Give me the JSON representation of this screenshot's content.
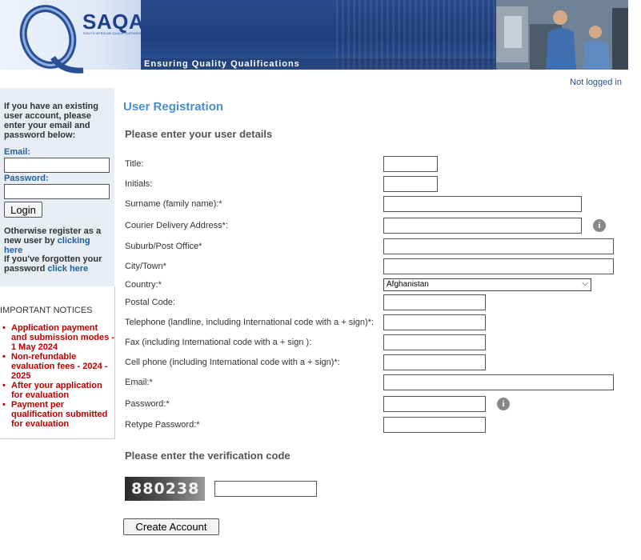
{
  "header": {
    "logo_text": "SAQA",
    "logo_subtext": "SOUTH AFRICAN QUALIFICATIONS AUTHORITY",
    "tagline": "Ensuring Quality Qualifications",
    "login_status": "Not logged in"
  },
  "sidebar": {
    "intro": "If you have an existing user account, please enter your email and password below:",
    "email_label": "Email:",
    "password_label": "Password:",
    "login_button": "Login",
    "register_text": "Otherwise register as a new user by",
    "register_link": "clicking here",
    "forgot_text": "If you've forgotten your password",
    "forgot_link": "click here",
    "notices_title": "IMPORTANT NOTICES",
    "notices": [
      "Application payment and submission modes - 1 May 2024",
      "Non-refundable evaluation fees - 2024 - 2025",
      "After your application for evaluation",
      "Payment per qualification submitted for evaluation"
    ]
  },
  "form": {
    "title": "User Registration",
    "details_heading": "Please enter your user details",
    "fields": {
      "title": "Title:",
      "initials": "Initials:",
      "surname": "Surname (family name):*",
      "courier": "Courier Delivery Address*:",
      "suburb": "Suburb/Post Office*",
      "city": "City/Town*",
      "country": "Country:*",
      "postal": "Postal Code:",
      "telephone": "Telephone (landline, including International code with a + sign)*:",
      "fax": "Fax (including International code with a + sign ):",
      "cell": "Cell phone (including International code with a + sign)*:",
      "email": "Email:*",
      "password": "Password:*",
      "retype": "Retype Password:*"
    },
    "country_value": "Afghanistan",
    "verification_heading": "Please enter the verification code",
    "captcha_code": "880238",
    "create_button": "Create Account"
  },
  "icons": {
    "info": "info-icon",
    "dropdown": "chevron-down-icon"
  },
  "colors": {
    "header_blue": "#1f3f7e",
    "title_blue": "#4a8ccc",
    "notice_red": "#bb0000",
    "sidebar_bg": "#e7edf3"
  }
}
